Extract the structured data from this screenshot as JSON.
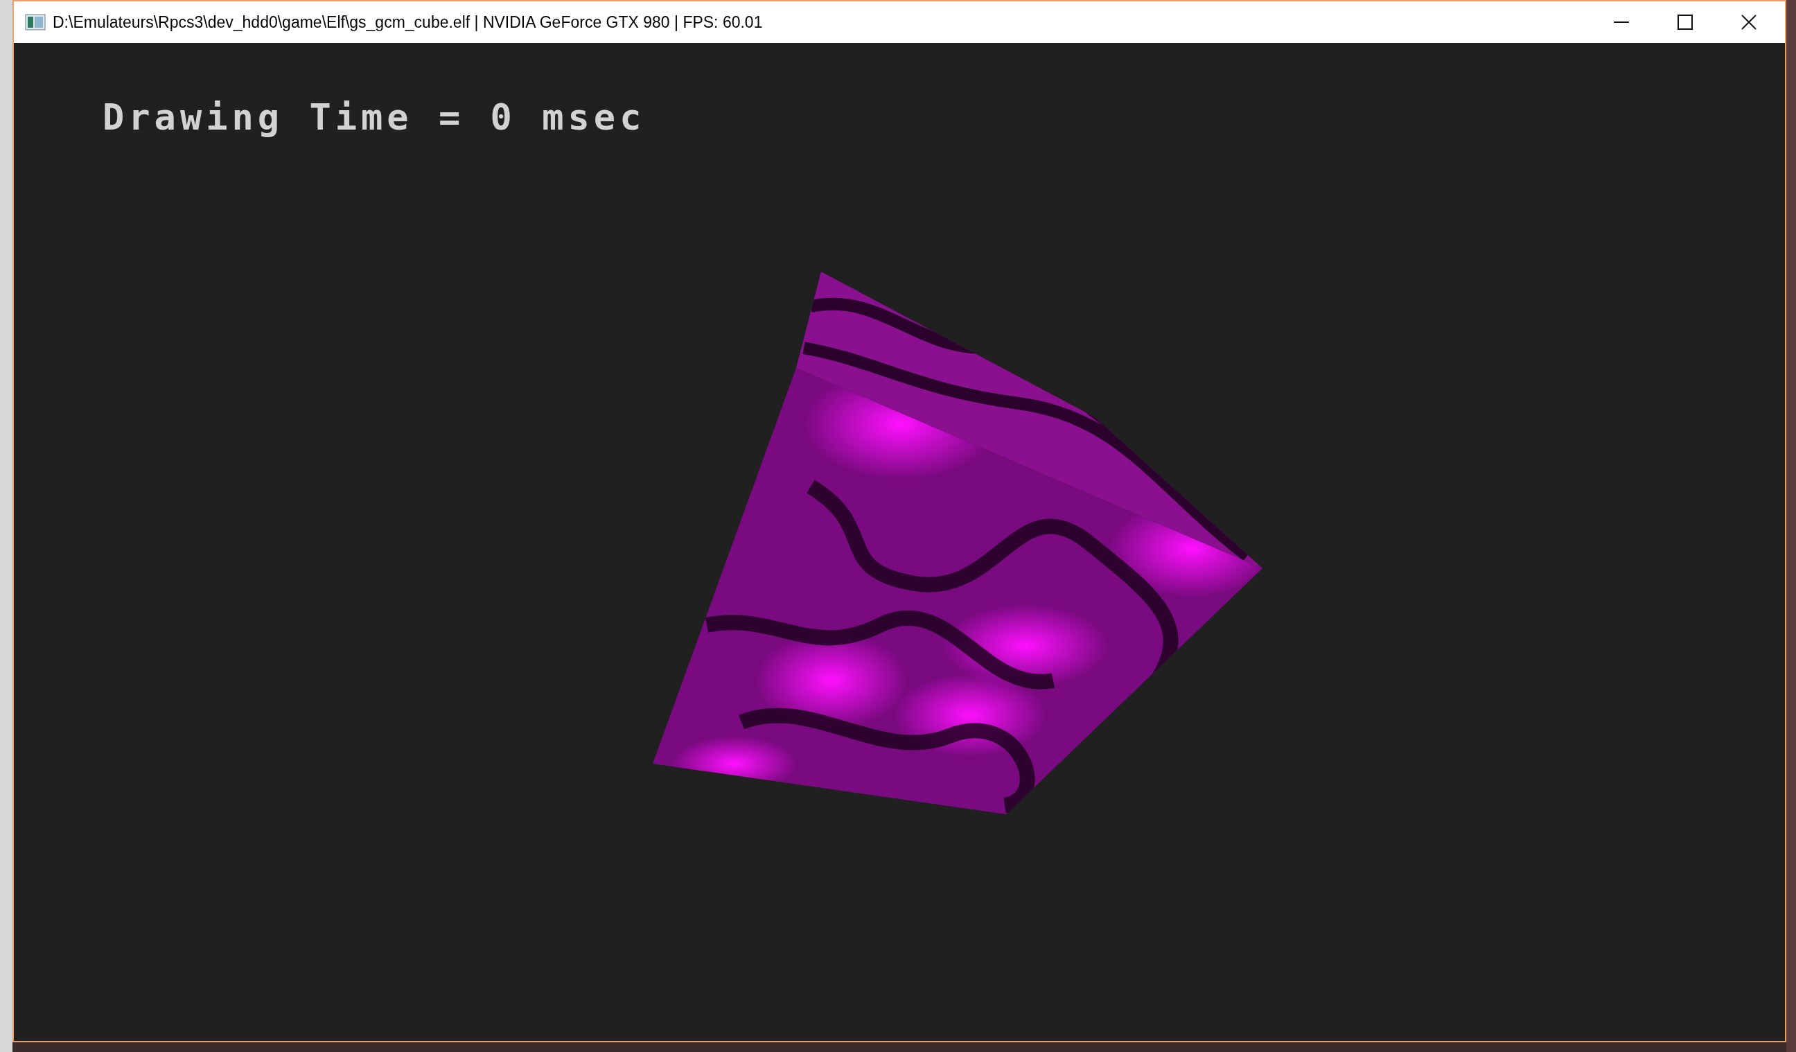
{
  "window": {
    "title": "D:\\Emulateurs\\Rpcs3\\dev_hdd0\\game\\Elf\\gs_gcm_cube.elf | NVIDIA GeForce GTX 980 | FPS: 60.01"
  },
  "viewport": {
    "overlay_text": "Drawing Time = 0 msec"
  }
}
